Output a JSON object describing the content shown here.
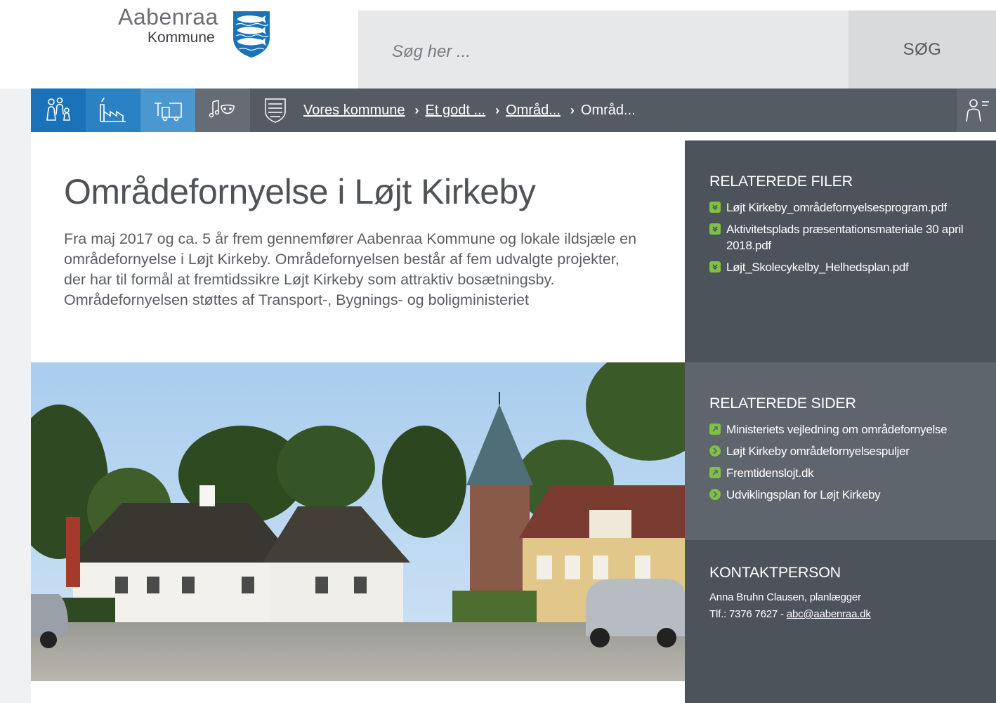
{
  "header": {
    "logo_line1": "Aabenraa",
    "logo_line2": "Kommune",
    "search_placeholder": "Søg her ...",
    "search_button": "SØG"
  },
  "nav": {
    "icons": [
      "family-icon",
      "factory-icon",
      "truck-icon",
      "culture-icon",
      "crest-icon",
      "user-icon"
    ],
    "breadcrumb": [
      {
        "label": "Vores kommune",
        "link": true
      },
      {
        "label": "Et godt ...",
        "link": true
      },
      {
        "label": "Områd...",
        "link": true
      },
      {
        "label": "Områd...",
        "link": false
      }
    ]
  },
  "main": {
    "title": "Områdefornyelse i Løjt Kirkeby",
    "intro": "Fra maj 2017 og ca. 5 år frem gennemfører Aabenraa Kommune og lokale ildsjæle en områdefornyelse i Løjt Kirkeby. Områdefornyelsen består af fem udvalgte projekter, der har til formål at fremtidssikre Løjt Kirkeby som attraktiv bosætningsby. Områdefornyelsen støttes af Transport-, Bygnings- og boligministeriet"
  },
  "sidebar": {
    "files": {
      "heading": "RELATEREDE FILER",
      "items": [
        {
          "label": "Løjt Kirkeby_områdefornyelsesprogram.pdf",
          "icon": "download-icon"
        },
        {
          "label": "Aktivitetsplads præsentationsmateriale 30 april 2018.pdf",
          "icon": "download-icon"
        },
        {
          "label": "Løjt_Skolecykelby_Helhedsplan.pdf",
          "icon": "download-icon"
        }
      ]
    },
    "pages": {
      "heading": "RELATEREDE SIDER",
      "items": [
        {
          "label": "Ministeriets vejledning om områdefornyelse",
          "icon": "external-link-icon"
        },
        {
          "label": "Løjt Kirkeby områdefornyelsespuljer",
          "icon": "arrow-right-icon"
        },
        {
          "label": "Fremtidenslojt.dk",
          "icon": "external-link-icon"
        },
        {
          "label": "Udviklingsplan for Løjt Kirkeby",
          "icon": "arrow-right-icon"
        }
      ]
    },
    "contact": {
      "heading": "KONTAKTPERSON",
      "name": "Anna Bruhn Clausen, planlægger",
      "phone_prefix": "Tlf.: 7376 7627 - ",
      "email": "abc@aabenraa.dk"
    }
  },
  "colors": {
    "nav_bg": "#555b62",
    "nav_blue_1": "#1a73b9",
    "nav_blue_2": "#2a82c4",
    "nav_blue_3": "#4b97cf",
    "sidebar_dark": "#4d535a",
    "sidebar_mid": "#5f656c",
    "icon_green": "#7dc242",
    "search_bg": "#e7e8e9"
  }
}
